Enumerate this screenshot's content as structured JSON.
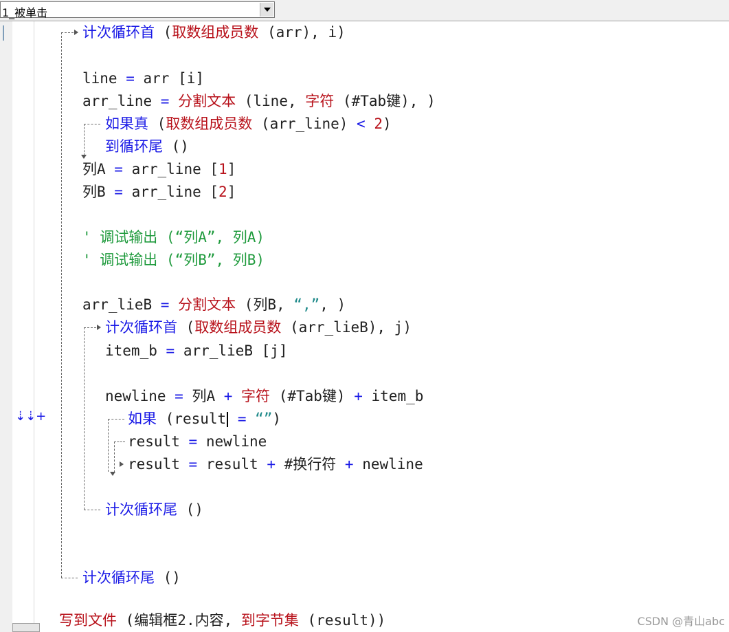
{
  "toolbar": {
    "combo_value": "1_被单击"
  },
  "gutter": {
    "marker": "⇣⇣+"
  },
  "code": {
    "l1": [
      {
        "t": "计次循环首 ",
        "c": "blue"
      },
      {
        "t": "(",
        "c": "dark"
      },
      {
        "t": "取数组成员数",
        "c": "red"
      },
      {
        "t": " (arr), i)",
        "c": "dark"
      }
    ],
    "l2": [
      {
        "t": "line ",
        "c": "dark"
      },
      {
        "t": "= ",
        "c": "blue"
      },
      {
        "t": "arr ",
        "c": "dark"
      },
      {
        "t": "[i]",
        "c": "dark"
      }
    ],
    "l3": [
      {
        "t": "arr_line ",
        "c": "dark"
      },
      {
        "t": "= ",
        "c": "blue"
      },
      {
        "t": "分割文本 ",
        "c": "red"
      },
      {
        "t": "(line, ",
        "c": "dark"
      },
      {
        "t": "字符 ",
        "c": "red"
      },
      {
        "t": "(#Tab键), )",
        "c": "dark"
      }
    ],
    "l4": [
      {
        "t": "如果真 ",
        "c": "blue"
      },
      {
        "t": "(",
        "c": "dark"
      },
      {
        "t": "取数组成员数",
        "c": "red"
      },
      {
        "t": " (arr_line) ",
        "c": "dark"
      },
      {
        "t": "< ",
        "c": "blue"
      },
      {
        "t": "2",
        "c": "red"
      },
      {
        "t": ")",
        "c": "dark"
      }
    ],
    "l5": [
      {
        "t": "到循环尾 ",
        "c": "blue"
      },
      {
        "t": "()",
        "c": "dark"
      }
    ],
    "l6": [
      {
        "t": "列A ",
        "c": "dark"
      },
      {
        "t": "= ",
        "c": "blue"
      },
      {
        "t": "arr_line ",
        "c": "dark"
      },
      {
        "t": "[",
        "c": "dark"
      },
      {
        "t": "1",
        "c": "red"
      },
      {
        "t": "]",
        "c": "dark"
      }
    ],
    "l7": [
      {
        "t": "列B ",
        "c": "dark"
      },
      {
        "t": "= ",
        "c": "blue"
      },
      {
        "t": "arr_line ",
        "c": "dark"
      },
      {
        "t": "[",
        "c": "dark"
      },
      {
        "t": "2",
        "c": "red"
      },
      {
        "t": "]",
        "c": "dark"
      }
    ],
    "l8": [
      {
        "t": "' 调试输出 (“列A”, 列A)",
        "c": "green"
      }
    ],
    "l9": [
      {
        "t": "' 调试输出 (“列B”, 列B)",
        "c": "green"
      }
    ],
    "l10": [
      {
        "t": "arr_lieB ",
        "c": "dark"
      },
      {
        "t": "= ",
        "c": "blue"
      },
      {
        "t": "分割文本 ",
        "c": "red"
      },
      {
        "t": "(列B, ",
        "c": "dark"
      },
      {
        "t": "“,”",
        "c": "teal"
      },
      {
        "t": ", )",
        "c": "dark"
      }
    ],
    "l11": [
      {
        "t": "计次循环首 ",
        "c": "blue"
      },
      {
        "t": "(",
        "c": "dark"
      },
      {
        "t": "取数组成员数",
        "c": "red"
      },
      {
        "t": " (arr_lieB), j)",
        "c": "dark"
      }
    ],
    "l12": [
      {
        "t": "item_b ",
        "c": "dark"
      },
      {
        "t": "= ",
        "c": "blue"
      },
      {
        "t": "arr_lieB [j]",
        "c": "dark"
      }
    ],
    "l13": [
      {
        "t": "newline ",
        "c": "dark"
      },
      {
        "t": "= ",
        "c": "blue"
      },
      {
        "t": "列A ",
        "c": "dark"
      },
      {
        "t": "+ ",
        "c": "blue"
      },
      {
        "t": "字符 ",
        "c": "red"
      },
      {
        "t": "(#Tab键) ",
        "c": "dark"
      },
      {
        "t": "+ ",
        "c": "blue"
      },
      {
        "t": "item_b",
        "c": "dark"
      }
    ],
    "l14a": [
      {
        "t": "如果 ",
        "c": "blue"
      },
      {
        "t": "(result",
        "c": "dark"
      }
    ],
    "l14b": [
      {
        "t": " = ",
        "c": "blue"
      },
      {
        "t": "“”",
        "c": "teal"
      },
      {
        "t": ")",
        "c": "dark"
      }
    ],
    "l15": [
      {
        "t": "result ",
        "c": "dark"
      },
      {
        "t": "= ",
        "c": "blue"
      },
      {
        "t": "newline",
        "c": "dark"
      }
    ],
    "l16": [
      {
        "t": "result ",
        "c": "dark"
      },
      {
        "t": "= ",
        "c": "blue"
      },
      {
        "t": "result ",
        "c": "dark"
      },
      {
        "t": "+ ",
        "c": "blue"
      },
      {
        "t": "#换行符 ",
        "c": "dark"
      },
      {
        "t": "+ ",
        "c": "blue"
      },
      {
        "t": "newline",
        "c": "dark"
      }
    ],
    "l17": [
      {
        "t": "计次循环尾 ",
        "c": "blue"
      },
      {
        "t": "()",
        "c": "dark"
      }
    ],
    "l18": [
      {
        "t": "计次循环尾 ",
        "c": "blue"
      },
      {
        "t": "()",
        "c": "dark"
      }
    ],
    "l19": [
      {
        "t": "写到文件 ",
        "c": "red"
      },
      {
        "t": "(编辑框2.内容, ",
        "c": "dark"
      },
      {
        "t": "到字节集 ",
        "c": "red"
      },
      {
        "t": "(result))",
        "c": "dark"
      }
    ]
  },
  "watermark": "CSDN @青山abc"
}
